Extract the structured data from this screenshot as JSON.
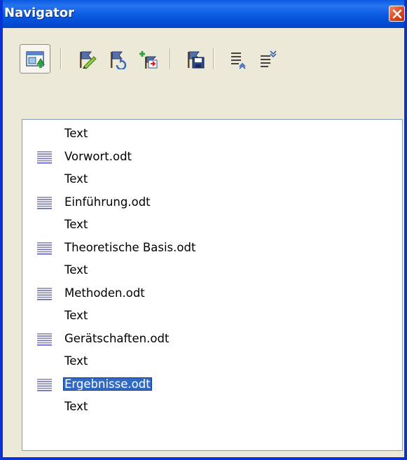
{
  "window": {
    "title": "Navigator"
  },
  "toolbar": {
    "buttons": [
      {
        "name": "toggle-icon",
        "tooltip": "Toggle"
      },
      {
        "name": "edit-icon",
        "tooltip": "Edit"
      },
      {
        "name": "update-icon",
        "tooltip": "Update"
      },
      {
        "name": "insert-icon",
        "tooltip": "Insert"
      },
      {
        "name": "save-contents-icon",
        "tooltip": "Save Contents as well"
      },
      {
        "name": "move-up-icon",
        "tooltip": "Move Up"
      },
      {
        "name": "move-down-icon",
        "tooltip": "Move Down"
      }
    ]
  },
  "tree": {
    "items": [
      {
        "label": "Text",
        "type": "text"
      },
      {
        "label": "Vorwort.odt",
        "type": "document"
      },
      {
        "label": "Text",
        "type": "text"
      },
      {
        "label": "Einführung.odt",
        "type": "document"
      },
      {
        "label": "Text",
        "type": "text"
      },
      {
        "label": "Theoretische Basis.odt",
        "type": "document"
      },
      {
        "label": "Text",
        "type": "text"
      },
      {
        "label": "Methoden.odt",
        "type": "document"
      },
      {
        "label": "Text",
        "type": "text"
      },
      {
        "label": "Gerätschaften.odt",
        "type": "document"
      },
      {
        "label": "Text",
        "type": "text"
      },
      {
        "label": "Ergebnisse.odt",
        "type": "document",
        "selected": true
      },
      {
        "label": "Text",
        "type": "text"
      }
    ]
  },
  "colors": {
    "titlebar": "#0a5ae0",
    "selection": "#316ac5",
    "face": "#ece9d8"
  }
}
